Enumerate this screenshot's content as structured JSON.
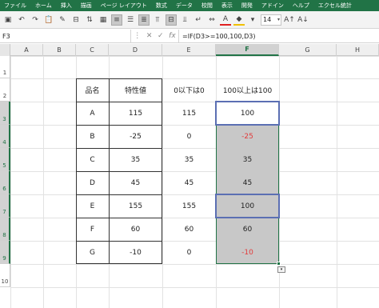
{
  "menu": [
    "ファイル",
    "ホーム",
    "挿入",
    "描画",
    "ページ レイアウト",
    "数式",
    "データ",
    "校閲",
    "表示",
    "開発",
    "アドイン",
    "ヘルプ",
    "エクセル統計"
  ],
  "toolbar": {
    "font_size": "14"
  },
  "formula_bar": {
    "name_box": "F3",
    "formula": "=IF(D3>=100,100,D3)"
  },
  "columns": [
    "A",
    "B",
    "C",
    "D",
    "E",
    "F",
    "G",
    "H"
  ],
  "rows": [
    "1",
    "2",
    "3",
    "4",
    "5",
    "6",
    "7",
    "8",
    "9",
    "10"
  ],
  "table": {
    "headers": [
      "品名",
      "特性値",
      "0以下は0",
      "100以上は100"
    ],
    "rows": [
      {
        "name": "A",
        "value": "115",
        "e": "115",
        "f": "100"
      },
      {
        "name": "B",
        "value": "-25",
        "e": "0",
        "f": "-25"
      },
      {
        "name": "C",
        "value": "35",
        "e": "35",
        "f": "35"
      },
      {
        "name": "D",
        "value": "45",
        "e": "45",
        "f": "45"
      },
      {
        "name": "E",
        "value": "155",
        "e": "155",
        "f": "100"
      },
      {
        "name": "F",
        "value": "60",
        "e": "60",
        "f": "60"
      },
      {
        "name": "G",
        "value": "-10",
        "e": "0",
        "f": "-10"
      }
    ]
  },
  "colors": {
    "accent": "#217346",
    "negative": "#e23b3b",
    "highlight": "#5b6fb3",
    "selection_fill": "#c8c8c8"
  }
}
